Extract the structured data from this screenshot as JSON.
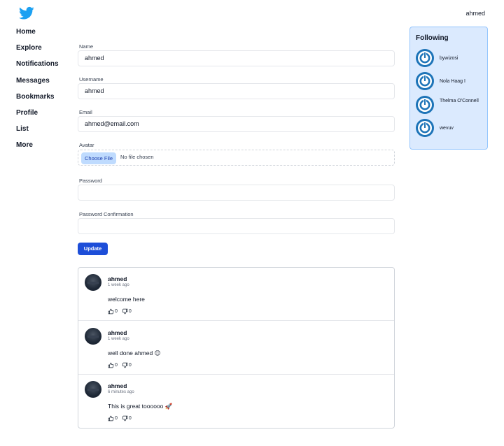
{
  "header": {
    "logo": "twitter-bird-icon",
    "username": "ahmed"
  },
  "nav": {
    "items": [
      "Home",
      "Explore",
      "Notifications",
      "Messages",
      "Bookmarks",
      "Profile",
      "List",
      "More"
    ]
  },
  "form": {
    "name": {
      "label": "Name",
      "value": "ahmed"
    },
    "username": {
      "label": "Username",
      "value": "ahmed"
    },
    "email": {
      "label": "Email",
      "value": "ahmed@email.com"
    },
    "avatar": {
      "label": "Avatar",
      "button": "Choose File",
      "status": "No file chosen"
    },
    "password": {
      "label": "Password",
      "value": ""
    },
    "password_confirmation": {
      "label": "Password Confirmation",
      "value": ""
    },
    "submit": "Update"
  },
  "posts": [
    {
      "author": "ahmed",
      "time": "1 week ago",
      "text": "welcome here",
      "likes": "0",
      "dislikes": "0"
    },
    {
      "author": "ahmed",
      "time": "1 week ago",
      "text": "well done ahmed 😊",
      "likes": "0",
      "dislikes": "0"
    },
    {
      "author": "ahmed",
      "time": "6 minutes ago",
      "text": "This is great toooooo 🚀",
      "likes": "0",
      "dislikes": "0"
    }
  ],
  "following": {
    "title": "Following",
    "users": [
      "bywizosi",
      "Nola Haag I",
      "Thelma O'Connell",
      "wevuv"
    ]
  },
  "colors": {
    "accent": "#1d4ed8",
    "panel": "#dbeafe",
    "logo": "#1da1f2",
    "avatar_ring": "#1d74b8"
  }
}
